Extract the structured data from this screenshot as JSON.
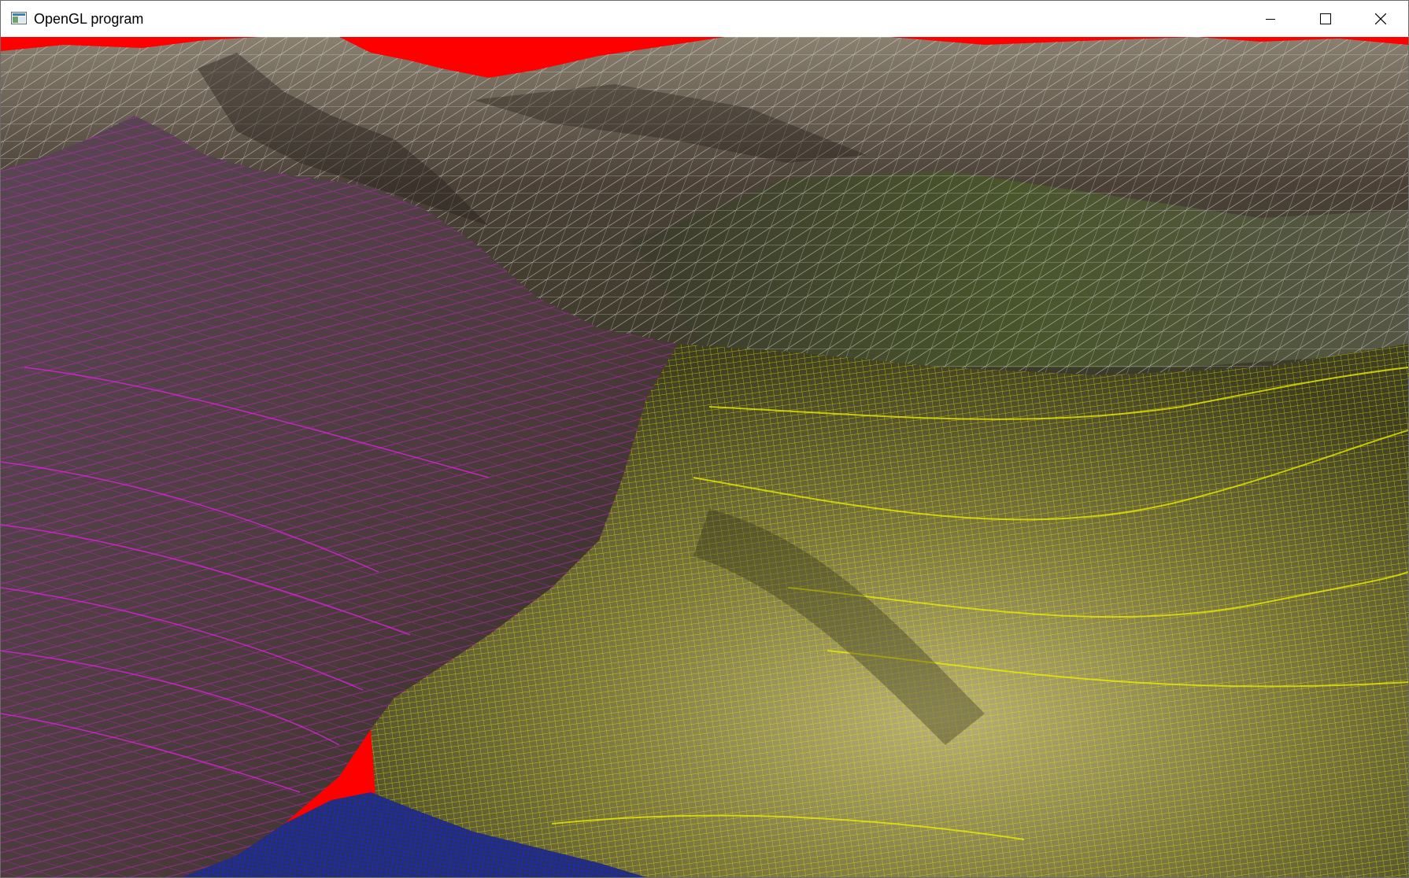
{
  "window": {
    "title": "OpenGL program",
    "controls": {
      "minimize": "minimize-icon",
      "maximize": "maximize-icon",
      "close": "close-icon"
    }
  },
  "scene": {
    "clear_color": "#ff0000",
    "terrain_color": "#4a4238",
    "wireframe_colors": [
      "#ffffff",
      "#ff00ff",
      "#ffff00",
      "#0000ff"
    ]
  }
}
